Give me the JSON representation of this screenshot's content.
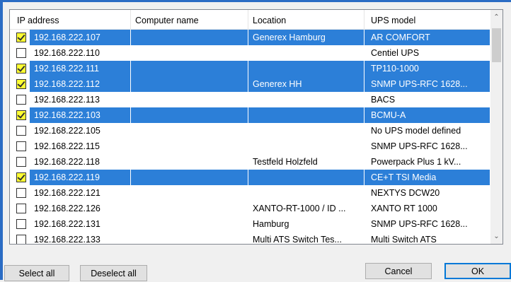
{
  "columns": {
    "ip": "IP address",
    "computer": "Computer name",
    "location": "Location",
    "ups": "UPS model"
  },
  "rows": [
    {
      "checked": true,
      "ip": "192.168.222.107",
      "computer": "",
      "location": "Generex Hamburg",
      "ups": "AR COMFORT"
    },
    {
      "checked": false,
      "ip": "192.168.222.110",
      "computer": "",
      "location": "",
      "ups": "Centiel UPS"
    },
    {
      "checked": true,
      "ip": "192.168.222.111",
      "computer": "",
      "location": "",
      "ups": "TP110-1000"
    },
    {
      "checked": true,
      "ip": "192.168.222.112",
      "computer": "",
      "location": "Generex HH",
      "ups": "SNMP UPS-RFC 1628..."
    },
    {
      "checked": false,
      "ip": "192.168.222.113",
      "computer": "",
      "location": "",
      "ups": "BACS"
    },
    {
      "checked": true,
      "ip": "192.168.222.103",
      "computer": "",
      "location": "",
      "ups": "BCMU-A"
    },
    {
      "checked": false,
      "ip": "192.168.222.105",
      "computer": "",
      "location": "",
      "ups": "No UPS model defined"
    },
    {
      "checked": false,
      "ip": "192.168.222.115",
      "computer": "",
      "location": "",
      "ups": "SNMP UPS-RFC 1628..."
    },
    {
      "checked": false,
      "ip": "192.168.222.118",
      "computer": "",
      "location": "Testfeld Holzfeld",
      "ups": "Powerpack Plus 1 kV..."
    },
    {
      "checked": true,
      "ip": "192.168.222.119",
      "computer": "",
      "location": "",
      "ups": "CE+T TSI Media"
    },
    {
      "checked": false,
      "ip": "192.168.222.121",
      "computer": "",
      "location": "",
      "ups": "NEXTYS DCW20"
    },
    {
      "checked": false,
      "ip": "192.168.222.126",
      "computer": "",
      "location": "XANTO-RT-1000 / ID ...",
      "ups": "XANTO RT 1000"
    },
    {
      "checked": false,
      "ip": "192.168.222.131",
      "computer": "",
      "location": "Hamburg",
      "ups": "SNMP UPS-RFC 1628..."
    },
    {
      "checked": false,
      "ip": "192.168.222.133",
      "computer": "",
      "location": "Multi ATS Switch Tes...",
      "ups": "Multi Switch ATS"
    }
  ],
  "buttons": {
    "select_all": "Select all",
    "deselect_all": "Deselect all",
    "cancel": "Cancel",
    "ok": "OK"
  },
  "icons": {
    "scroll_up": "scroll-up-arrow",
    "scroll_down": "scroll-down-arrow",
    "check": "checkmark"
  },
  "colors": {
    "selection": "#2c7fd8",
    "checkbox_fill": "#ffff33",
    "window_frame": "#2b6cc4"
  }
}
